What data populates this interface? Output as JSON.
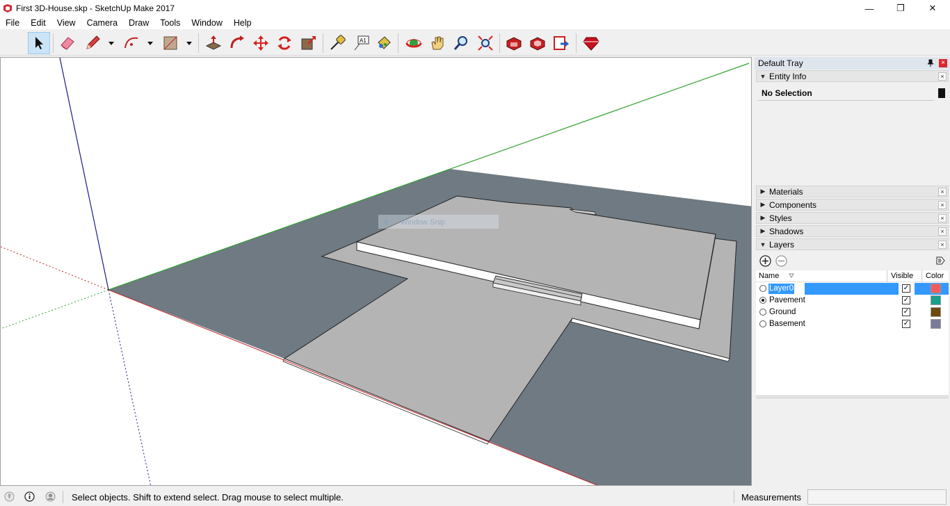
{
  "window": {
    "title": "First 3D-House.skp - SketchUp Make 2017",
    "minimize_glyph": "—",
    "maximize_glyph": "❐",
    "close_glyph": "✕"
  },
  "menu": [
    "File",
    "Edit",
    "View",
    "Camera",
    "Draw",
    "Tools",
    "Window",
    "Help"
  ],
  "toolbar": {
    "tools": [
      "select-icon",
      "eraser-icon",
      "pencil-icon",
      "arc-icon",
      "rectangle-icon",
      "push-pull-icon",
      "follow-me-icon",
      "move-icon",
      "rotate-icon",
      "scale-icon",
      "tape-measure-icon",
      "text-icon",
      "paint-bucket-icon",
      "orbit-icon",
      "pan-icon",
      "zoom-icon",
      "zoom-extents-icon",
      "3d-warehouse-icon",
      "extension-warehouse-icon",
      "send-to-layout-icon",
      "extension-manager-icon"
    ],
    "active_tool": "select-icon"
  },
  "viewport": {
    "overlay_text": "Window Snip"
  },
  "tray": {
    "title": "Default Tray",
    "pin_glyph": "📌",
    "close_glyph": "×",
    "entity_info": {
      "title": "Entity Info",
      "value": "No Selection"
    },
    "panels": [
      "Materials",
      "Components",
      "Styles",
      "Shadows"
    ],
    "layers": {
      "title": "Layers",
      "columns": {
        "name": "Name",
        "visible": "Visible",
        "color": "Color"
      },
      "rows": [
        {
          "name": "Layer0",
          "active": false,
          "selected": true,
          "visible": true,
          "color": "#f05a5a"
        },
        {
          "name": "Pavement",
          "active": true,
          "selected": false,
          "visible": true,
          "color": "#14a08c"
        },
        {
          "name": "Ground",
          "active": false,
          "selected": false,
          "visible": true,
          "color": "#6e4a10"
        },
        {
          "name": "Basement",
          "active": false,
          "selected": false,
          "visible": true,
          "color": "#7a7a9a"
        }
      ]
    }
  },
  "status": {
    "hint": "Select objects. Shift to extend select. Drag mouse to select multiple.",
    "measurements_label": "Measurements",
    "measurements_value": ""
  },
  "colors": {
    "ground": "#6f7a83",
    "house_top": "#b4b4b4",
    "axis_red": "#c02020",
    "axis_green": "#30a030",
    "axis_blue": "#1a1a8a"
  }
}
